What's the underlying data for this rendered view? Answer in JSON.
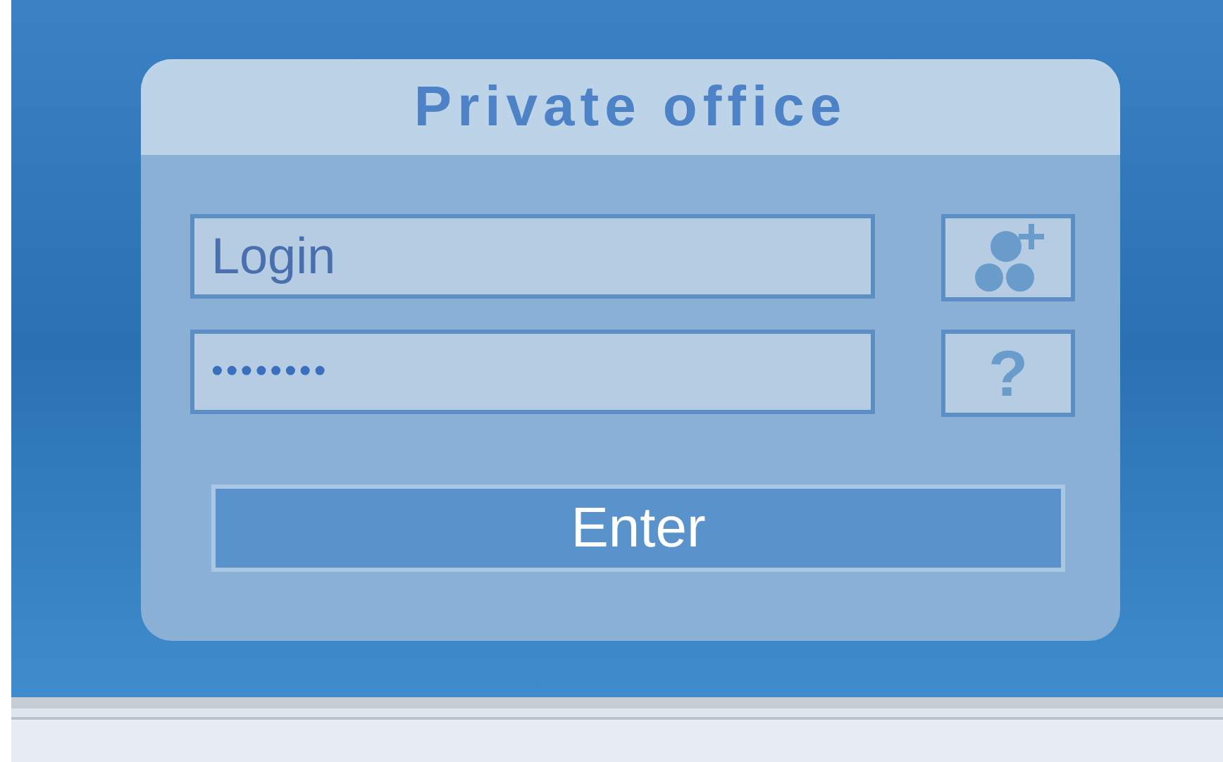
{
  "panel": {
    "title": "Private office"
  },
  "login_field": {
    "placeholder": "Login"
  },
  "password_field": {
    "value": "••••••••"
  },
  "buttons": [
    {
      "kind": "register"
    },
    {
      "kind": "help",
      "label": "?"
    }
  ],
  "enter_button": {
    "label": "Enter"
  }
}
